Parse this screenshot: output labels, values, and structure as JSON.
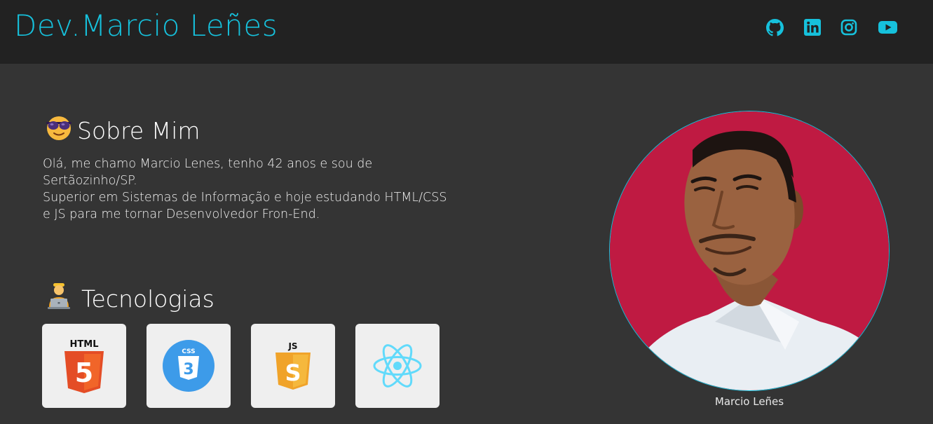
{
  "header": {
    "brand": "Dev.Marcio Leñes",
    "accent_color": "#16c1dc",
    "social": [
      {
        "name": "github",
        "icon": "github-icon"
      },
      {
        "name": "linkedin",
        "icon": "linkedin-icon"
      },
      {
        "name": "instagram",
        "icon": "instagram-icon"
      },
      {
        "name": "youtube",
        "icon": "youtube-icon"
      }
    ]
  },
  "about": {
    "title": "Sobre Mim",
    "emoji_icon": "sunglasses-face-icon",
    "paragraphs": [
      "Olá, me chamo Marcio Lenes, tenho 42 anos e sou de Sertãozinho/SP.",
      "Superior em Sistemas de Informação e hoje estudando HTML/CSS e JS para me tornar Desenvolvedor Fron-End."
    ]
  },
  "tech": {
    "title": "Tecnologias",
    "emoji_icon": "technologist-icon",
    "items": [
      {
        "name": "HTML",
        "label": "HTML",
        "badge": "5",
        "color": "#e44d26",
        "icon": "html5-icon"
      },
      {
        "name": "CSS",
        "label": "CSS",
        "badge": "3",
        "color": "#2965f1",
        "icon": "css3-icon"
      },
      {
        "name": "JS",
        "label": "JS",
        "badge": "S",
        "color": "#f0a32a",
        "icon": "javascript-icon"
      },
      {
        "name": "React",
        "color": "#61dafb",
        "icon": "react-icon"
      }
    ]
  },
  "profile": {
    "caption": "Marcio Leñes",
    "background_color": "#c61c45"
  }
}
